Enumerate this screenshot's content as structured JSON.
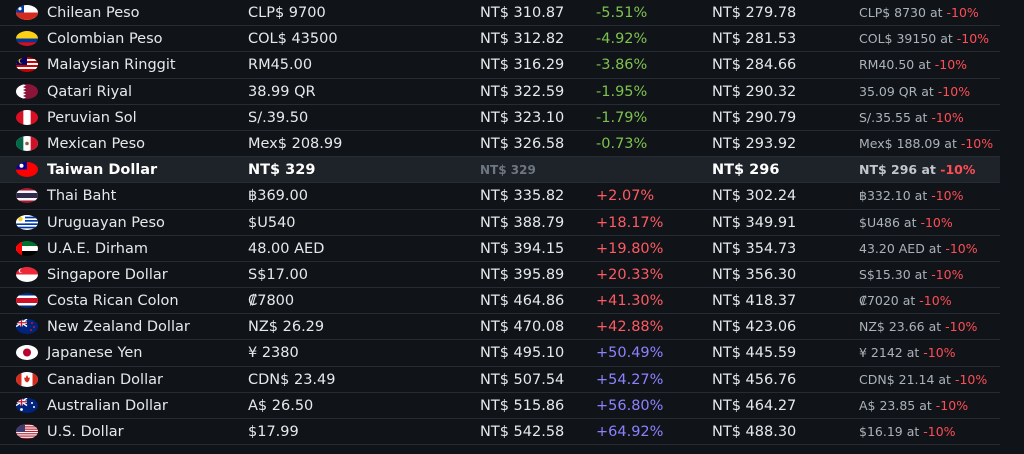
{
  "rows": [
    {
      "flag": "cl",
      "name": "Chilean Peso",
      "local": "CLP$ 9700",
      "converted": "NT$ 310.87",
      "diff": "-5.51%",
      "diff_kind": "neg",
      "sale": "NT$ 279.78",
      "sale_local": "CLP$ 8730 at ",
      "discount": "-10%"
    },
    {
      "flag": "co",
      "name": "Colombian Peso",
      "local": "COL$ 43500",
      "converted": "NT$ 312.82",
      "diff": "-4.92%",
      "diff_kind": "neg",
      "sale": "NT$ 281.53",
      "sale_local": "COL$ 39150 at ",
      "discount": "-10%"
    },
    {
      "flag": "my",
      "name": "Malaysian Ringgit",
      "local": "RM45.00",
      "converted": "NT$ 316.29",
      "diff": "-3.86%",
      "diff_kind": "neg",
      "sale": "NT$ 284.66",
      "sale_local": "RM40.50 at ",
      "discount": "-10%"
    },
    {
      "flag": "qa",
      "name": "Qatari Riyal",
      "local": "38.99 QR",
      "converted": "NT$ 322.59",
      "diff": "-1.95%",
      "diff_kind": "neg",
      "sale": "NT$ 290.32",
      "sale_local": "35.09 QR at ",
      "discount": "-10%"
    },
    {
      "flag": "pe",
      "name": "Peruvian Sol",
      "local": "S/.39.50",
      "converted": "NT$ 323.10",
      "diff": "-1.79%",
      "diff_kind": "neg",
      "sale": "NT$ 290.79",
      "sale_local": "S/.35.55 at ",
      "discount": "-10%"
    },
    {
      "flag": "mx",
      "name": "Mexican Peso",
      "local": "Mex$ 208.99",
      "converted": "NT$ 326.58",
      "diff": "-0.73%",
      "diff_kind": "neg",
      "sale": "NT$ 293.92",
      "sale_local": "Mex$ 188.09 at ",
      "discount": "-10%"
    },
    {
      "flag": "tw",
      "name": "Taiwan Dollar",
      "local": "NT$ 329",
      "converted": "NT$ 329",
      "diff": "",
      "diff_kind": "none",
      "sale": "NT$ 296",
      "sale_local": "NT$ 296 at ",
      "discount": "-10%",
      "highlight": true
    },
    {
      "flag": "th",
      "name": "Thai Baht",
      "local": "฿369.00",
      "converted": "NT$ 335.82",
      "diff": "+2.07%",
      "diff_kind": "red",
      "sale": "NT$ 302.24",
      "sale_local": "฿332.10 at ",
      "discount": "-10%"
    },
    {
      "flag": "uy",
      "name": "Uruguayan Peso",
      "local": "$U540",
      "converted": "NT$ 388.79",
      "diff": "+18.17%",
      "diff_kind": "red",
      "sale": "NT$ 349.91",
      "sale_local": "$U486 at ",
      "discount": "-10%"
    },
    {
      "flag": "ae",
      "name": "U.A.E. Dirham",
      "local": "48.00 AED",
      "converted": "NT$ 394.15",
      "diff": "+19.80%",
      "diff_kind": "red",
      "sale": "NT$ 354.73",
      "sale_local": "43.20 AED at ",
      "discount": "-10%"
    },
    {
      "flag": "sg",
      "name": "Singapore Dollar",
      "local": "S$17.00",
      "converted": "NT$ 395.89",
      "diff": "+20.33%",
      "diff_kind": "red",
      "sale": "NT$ 356.30",
      "sale_local": "S$15.30 at ",
      "discount": "-10%"
    },
    {
      "flag": "cr",
      "name": "Costa Rican Colon",
      "local": "₡7800",
      "converted": "NT$ 464.86",
      "diff": "+41.30%",
      "diff_kind": "red",
      "sale": "NT$ 418.37",
      "sale_local": "₡7020 at ",
      "discount": "-10%"
    },
    {
      "flag": "nz",
      "name": "New Zealand Dollar",
      "local": "NZ$ 26.29",
      "converted": "NT$ 470.08",
      "diff": "+42.88%",
      "diff_kind": "red",
      "sale": "NT$ 423.06",
      "sale_local": "NZ$ 23.66 at ",
      "discount": "-10%"
    },
    {
      "flag": "jp",
      "name": "Japanese Yen",
      "local": "¥ 2380",
      "converted": "NT$ 495.10",
      "diff": "+50.49%",
      "diff_kind": "purple",
      "sale": "NT$ 445.59",
      "sale_local": "¥ 2142 at ",
      "discount": "-10%"
    },
    {
      "flag": "ca",
      "name": "Canadian Dollar",
      "local": "CDN$ 23.49",
      "converted": "NT$ 507.54",
      "diff": "+54.27%",
      "diff_kind": "purple",
      "sale": "NT$ 456.76",
      "sale_local": "CDN$ 21.14 at ",
      "discount": "-10%"
    },
    {
      "flag": "au",
      "name": "Australian Dollar",
      "local": "A$ 26.50",
      "converted": "NT$ 515.86",
      "diff": "+56.80%",
      "diff_kind": "purple",
      "sale": "NT$ 464.27",
      "sale_local": "A$ 23.85 at ",
      "discount": "-10%"
    },
    {
      "flag": "us",
      "name": "U.S. Dollar",
      "local": "$17.99",
      "converted": "NT$ 542.58",
      "diff": "+64.92%",
      "diff_kind": "purple",
      "sale": "NT$ 488.30",
      "sale_local": "$16.19 at ",
      "discount": "-10%"
    }
  ]
}
